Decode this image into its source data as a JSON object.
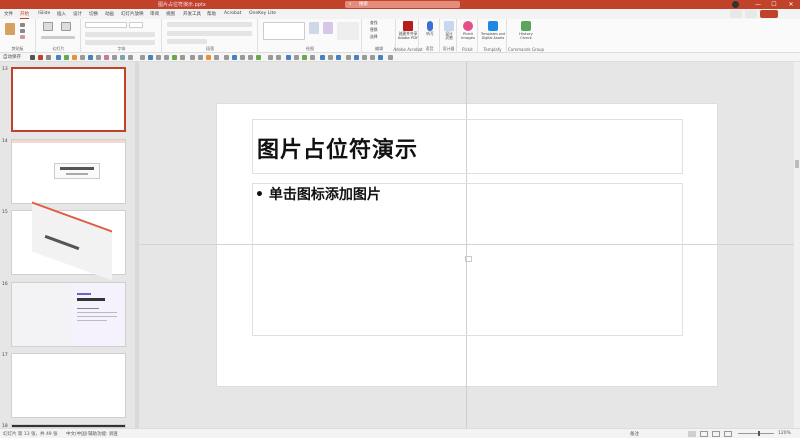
{
  "titlebar": {
    "filename": "图片占位符演示.pptx",
    "search_placeholder": "搜索",
    "minimize": "—",
    "maximize": "☐",
    "close": "✕"
  },
  "tabs": [
    "文件",
    "开始",
    "iSlide",
    "插入",
    "设计",
    "切换",
    "动画",
    "幻灯片放映",
    "审阅",
    "视图",
    "开发工具",
    "帮助",
    "Acrobat",
    "OneKey Lite"
  ],
  "active_tab": "开始",
  "ribbon": {
    "groups": [
      "剪贴板",
      "幻灯片",
      "字体",
      "段落",
      "绘图",
      "编辑",
      "Adobe Acrobat",
      "语音",
      "设计器",
      "Pickit",
      "Templafy",
      "Commands Group"
    ],
    "buttons": {
      "paste": "粘贴",
      "new_slide": "新建\n幻灯片",
      "reuse": "重用\n幻灯片",
      "find": "查找",
      "replace": "替换",
      "select": "选择",
      "create_pdf": "创建并共享\nAdobe PDF",
      "dictate": "听写",
      "design_ideas": "设计\n灵感",
      "pickit": "Pickit\nImages",
      "templafy": "Templates and\nDigital Assets",
      "history": "History\nCheck"
    }
  },
  "qat": {
    "autosave": "自动保存"
  },
  "thumbnails": [
    {
      "num": "13",
      "selected": true
    },
    {
      "num": "14",
      "selected": false
    },
    {
      "num": "15",
      "selected": false
    },
    {
      "num": "16",
      "selected": false
    },
    {
      "num": "17",
      "selected": false
    },
    {
      "num": "18",
      "selected": false
    }
  ],
  "slide": {
    "title": "图片占位符演示",
    "bullet": "• 单击图标添加图片"
  },
  "status": {
    "slide_pos": "幻灯片 第 13 张，共 49 张",
    "lang": "中文(中国)",
    "accessibility": "辅助功能: 调查",
    "notes": "备注",
    "zoom": "120%"
  },
  "colors": {
    "accent": "#c0422b"
  }
}
